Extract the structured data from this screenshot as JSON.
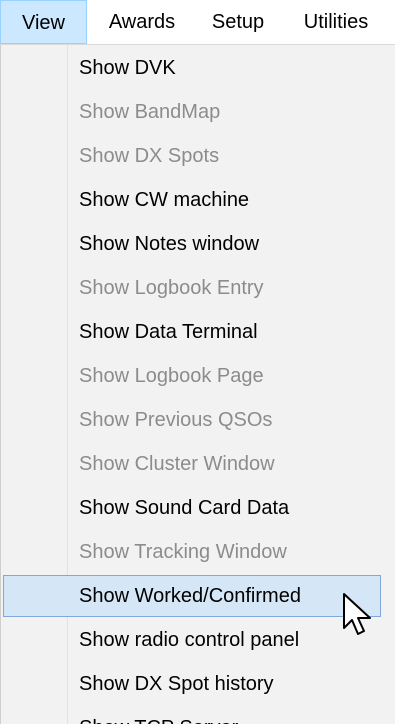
{
  "menubar": {
    "items": [
      {
        "label": "View"
      },
      {
        "label": "Awards"
      },
      {
        "label": "Setup"
      },
      {
        "label": "Utilities"
      }
    ]
  },
  "view_menu": {
    "items": [
      {
        "label": "Show DVK",
        "enabled": true
      },
      {
        "label": "Show BandMap",
        "enabled": false
      },
      {
        "label": "Show DX Spots",
        "enabled": false
      },
      {
        "label": "Show CW machine",
        "enabled": true
      },
      {
        "label": "Show Notes window",
        "enabled": true
      },
      {
        "label": "Show Logbook Entry",
        "enabled": false
      },
      {
        "label": "Show Data Terminal",
        "enabled": true
      },
      {
        "label": "Show Logbook Page",
        "enabled": false
      },
      {
        "label": "Show Previous QSOs",
        "enabled": false
      },
      {
        "label": "Show Cluster Window",
        "enabled": false
      },
      {
        "label": "Show Sound Card Data",
        "enabled": true
      },
      {
        "label": "Show Tracking Window",
        "enabled": false
      },
      {
        "label": "Show Worked/Confirmed",
        "enabled": true,
        "highlighted": true
      },
      {
        "label": "Show radio control panel",
        "enabled": true
      },
      {
        "label": "Show DX Spot history",
        "enabled": true
      },
      {
        "label": "Show TCP Server",
        "enabled": true
      }
    ]
  },
  "colors": {
    "menubar_active_bg": "#cce8ff",
    "dropdown_bg": "#f2f2f2",
    "highlight_bg": "#d5e6f7",
    "highlight_border": "#7fa9dc",
    "disabled_text": "#8c8c8c"
  },
  "icons": {
    "pointer": "mouse-pointer-icon"
  }
}
